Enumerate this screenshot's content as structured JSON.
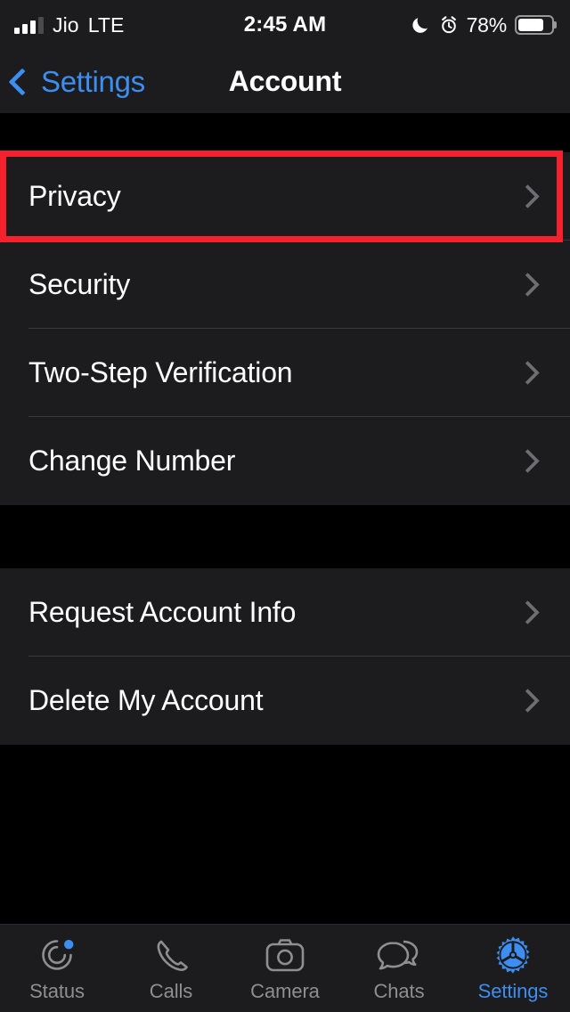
{
  "status_bar": {
    "carrier": "Jio",
    "radio_type": "LTE",
    "time": "2:45 AM",
    "battery_percent": "78%",
    "battery_level": 78,
    "icons": [
      "signal-bars-icon",
      "do-not-disturb-moon-icon",
      "alarm-clock-icon",
      "battery-icon"
    ]
  },
  "nav_bar": {
    "back_label": "Settings",
    "title": "Account"
  },
  "groups": [
    {
      "rows": [
        {
          "label": "Privacy",
          "highlighted": true
        },
        {
          "label": "Security",
          "highlighted": false
        },
        {
          "label": "Two-Step Verification",
          "highlighted": false
        },
        {
          "label": "Change Number",
          "highlighted": false
        }
      ]
    },
    {
      "rows": [
        {
          "label": "Request Account Info",
          "highlighted": false
        },
        {
          "label": "Delete My Account",
          "highlighted": false
        }
      ]
    }
  ],
  "highlight": {
    "color": "#f5212d",
    "target": "Privacy"
  },
  "tab_bar": {
    "active": "Settings",
    "tabs": [
      {
        "label": "Status",
        "icon": "status-rings-icon",
        "badge": true
      },
      {
        "label": "Calls",
        "icon": "phone-handset-icon",
        "badge": false
      },
      {
        "label": "Camera",
        "icon": "camera-icon",
        "badge": false
      },
      {
        "label": "Chats",
        "icon": "chat-bubbles-icon",
        "badge": false
      },
      {
        "label": "Settings",
        "icon": "gear-icon",
        "badge": false
      }
    ]
  },
  "colors": {
    "accent": "#3c8ef0",
    "row_background": "#1c1c1e",
    "page_background": "#000000",
    "separator": "#3a3a3c",
    "chevron": "#6d6d72",
    "inactive_tab": "#8e8e93"
  }
}
